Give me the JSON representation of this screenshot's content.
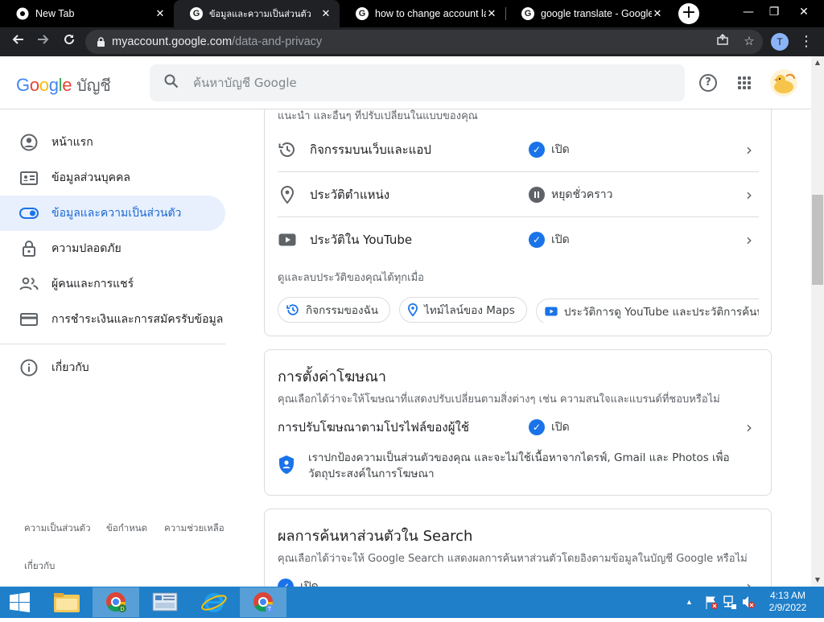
{
  "browser": {
    "tabs": [
      {
        "title": "New Tab",
        "active": false
      },
      {
        "title": "ข้อมูลและความเป็นส่วนตัว",
        "active": true
      },
      {
        "title": "how to change account lan",
        "active": false
      },
      {
        "title": "google translate - Google",
        "active": false
      }
    ],
    "url_host": "myaccount.google.com",
    "url_path": "/data-and-privacy",
    "profile_initial": "T"
  },
  "header": {
    "product": "บัญชี",
    "search_placeholder": "ค้นหาบัญชี Google"
  },
  "sidebar": {
    "items": [
      {
        "label": "หน้าแรก",
        "icon": "account-circle-icon"
      },
      {
        "label": "ข้อมูลส่วนบุคคล",
        "icon": "id-card-icon"
      },
      {
        "label": "ข้อมูลและความเป็นส่วนตัว",
        "icon": "toggle-icon",
        "active": true
      },
      {
        "label": "ความปลอดภัย",
        "icon": "lock-icon"
      },
      {
        "label": "ผู้คนและการแชร์",
        "icon": "people-icon"
      },
      {
        "label": "การชำระเงินและการสมัครรับข้อมูล",
        "icon": "credit-card-icon"
      },
      {
        "label": "เกี่ยวกับ",
        "icon": "info-icon"
      }
    ],
    "footer": [
      "ความเป็นส่วนตัว",
      "ข้อกำหนด",
      "ความช่วยเหลือ",
      "เกี่ยวกับ"
    ]
  },
  "history_card": {
    "truncated_text": "แนะนำ และอื่นๆ ที่ปรับเปลี่ยนในแบบของคุณ",
    "rows": [
      {
        "label": "กิจกรรมบนเว็บและแอป",
        "status": "เปิด",
        "state": "on"
      },
      {
        "label": "ประวัติตำแหน่ง",
        "status": "หยุดชั่วคราว",
        "state": "paused"
      },
      {
        "label": "ประวัติใน YouTube",
        "status": "เปิด",
        "state": "on"
      }
    ],
    "note": "ดูและลบประวัติของคุณได้ทุกเมื่อ",
    "chips": [
      "กิจกรรมของฉัน",
      "ไทม์ไลน์ของ Maps",
      "ประวัติการดู YouTube และประวัติการค้นหา"
    ]
  },
  "ads_card": {
    "title": "การตั้งค่าโฆษณา",
    "desc": "คุณเลือกได้ว่าจะให้โฆษณาที่แสดงปรับเปลี่ยนตามสิ่งต่างๆ เช่น ความสนใจและแบรนด์ที่ชอบหรือไม่",
    "row_label": "การปรับโฆษณาตามโปรไฟล์ของผู้ใช้",
    "row_status": "เปิด",
    "shield_text": "เราปกป้องความเป็นส่วนตัวของคุณ และจะไม่ใช้เนื้อหาจากไดรฟ์, Gmail และ Photos เพื่อวัตถุประสงค์ในการโฆษณา"
  },
  "search_card": {
    "title": "ผลการค้นหาส่วนตัวใน Search",
    "desc": "คุณเลือกได้ว่าจะให้ Google Search แสดงผลการค้นหาส่วนตัวโดยอิงตามข้อมูลในบัญชี Google หรือไม่",
    "row_status": "เปิด"
  },
  "taskbar": {
    "time": "4:13 AM",
    "date": "2/9/2022"
  }
}
